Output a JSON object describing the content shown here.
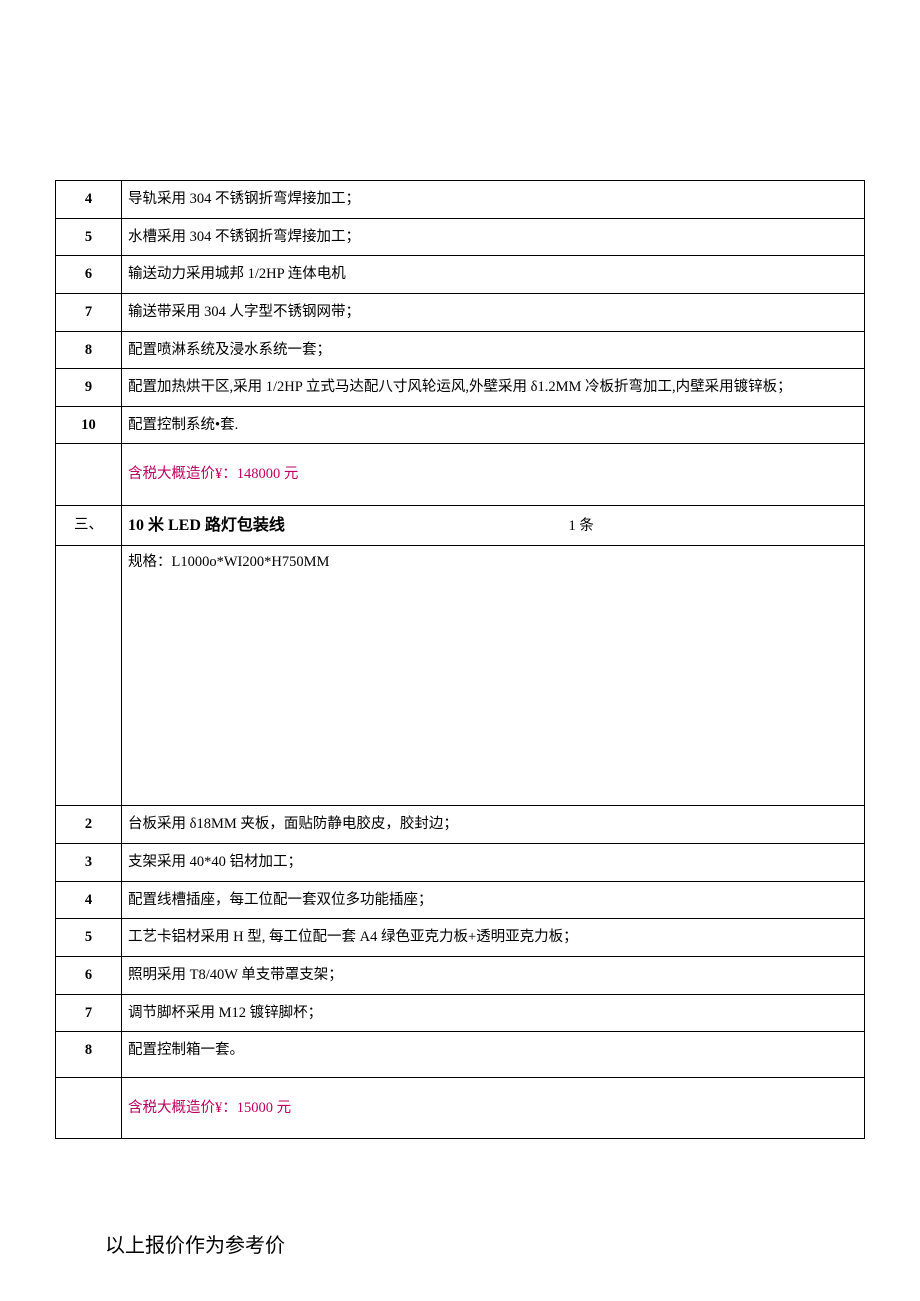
{
  "section2": {
    "rows": [
      {
        "n": "4",
        "text": "导轨采用 304 不锈钢折弯焊接加工；"
      },
      {
        "n": "5",
        "text": "水槽采用 304 不锈钢折弯焊接加工；"
      },
      {
        "n": "6",
        "text": "输送动力采用城邦 1/2HP 连体电机"
      },
      {
        "n": "7",
        "text": "输送带采用 304 人字型不锈钢网带；"
      },
      {
        "n": "8",
        "text": "配置喷淋系统及浸水系统一套；"
      },
      {
        "n": "9",
        "text": "配置加热烘干区,采用 1/2HP 立式马达配八寸风轮运风,外壁采用 δ1.2MM 冷板折弯加工,内壁采用镀锌板；"
      },
      {
        "n": "10",
        "text": "配置控制系统•套."
      }
    ],
    "price": "含税大概造价¥：148000 元"
  },
  "section3": {
    "header_num": "三、",
    "title": "10 米 LED 路灯包装线",
    "qty": "1 条",
    "spec": "规格：L1000o*WI200*H750MM",
    "rows": [
      {
        "n": "2",
        "text": "台板采用 δ18MM 夹板，面贴防静电胶皮，胶封边；"
      },
      {
        "n": "3",
        "text": "支架采用 40*40 铝材加工；"
      },
      {
        "n": "4",
        "text": "配置线槽插座，每工位配一套双位多功能插座；"
      },
      {
        "n": "5",
        "text": "工艺卡铝材采用 H 型, 每工位配一套 A4 绿色亚克力板+透明亚克力板；"
      },
      {
        "n": "6",
        "text": "照明采用 T8/40W 单支带罩支架；"
      },
      {
        "n": "7",
        "text": "调节脚杯采用 M12 镀锌脚杯；"
      },
      {
        "n": "8",
        "text": "配置控制箱一套。"
      }
    ],
    "price": "含税大概造价¥：15000 元"
  },
  "footer": "以上报价作为参考价"
}
